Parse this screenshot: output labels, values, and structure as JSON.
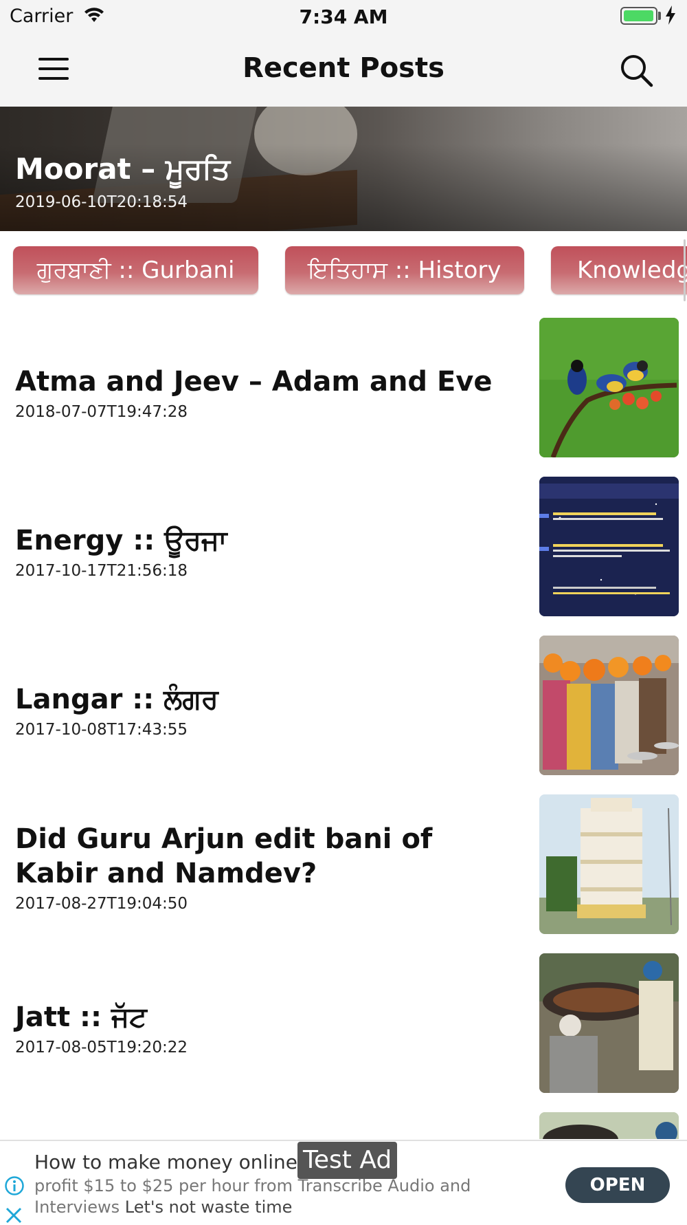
{
  "status_bar": {
    "carrier": "Carrier",
    "time": "7:34 AM",
    "battery_color": "#4cd964"
  },
  "nav": {
    "title": "Recent Posts",
    "menu_icon": "hamburger-menu-icon",
    "search_icon": "search-icon"
  },
  "featured": {
    "title": "Moorat – ਮੂਰਤਿ",
    "date": "2019-06-10T20:18:54"
  },
  "categories": [
    {
      "label": "ਗੁਰਬਾਣੀ :: Gurbani"
    },
    {
      "label": "ਇਤਿਹਾਸ :: History"
    },
    {
      "label": "Knowledg"
    }
  ],
  "posts": [
    {
      "title": "Atma and Jeev – Adam and Eve",
      "date": "2018-07-07T19:47:28"
    },
    {
      "title": "Energy :: ਊਰਜਾ",
      "date": "2017-10-17T21:56:18"
    },
    {
      "title": "Langar :: ਲੰਗਰ",
      "date": "2017-10-08T17:43:55"
    },
    {
      "title": "Did Guru Arjun edit bani of Kabir and Namdev?",
      "date": "2017-08-27T19:04:50"
    },
    {
      "title": "Jatt :: ਜੱਟ",
      "date": "2017-08-05T19:20:22"
    }
  ],
  "ad": {
    "badge": "Test Ad",
    "headline": "How to make money online",
    "body": "profit $15 to $25 per hour from Transcribe Audio and Interviews",
    "body_cta": "Let's not waste time",
    "button": "OPEN",
    "button_color": "#344552"
  }
}
